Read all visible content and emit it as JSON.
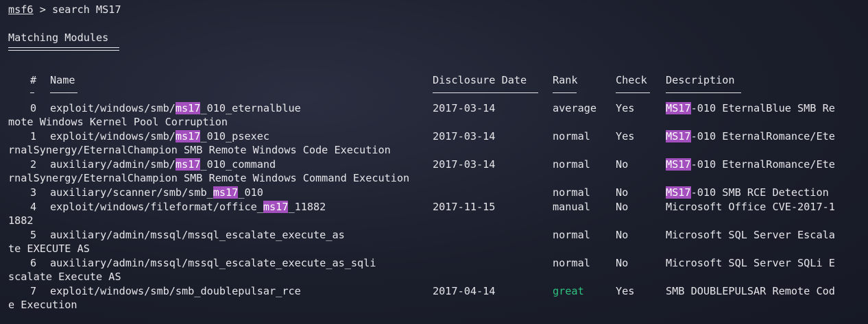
{
  "prompt": {
    "name": "msf6",
    "sep": " > ",
    "command": "search MS17"
  },
  "heading": "Matching Modules",
  "headers": {
    "num": "#",
    "name": "Name",
    "date": "Disclosure Date",
    "rank": "Rank",
    "check": "Check",
    "desc": "Description"
  },
  "highlight_term": "ms17",
  "rows": [
    {
      "num": "0",
      "name_pre": "exploit/windows/smb/",
      "name_hl": "ms17",
      "name_post": "_010_eternalblue",
      "date": "2017-03-14",
      "rank": "average",
      "check": "Yes",
      "desc_hl": "MS17",
      "desc_line1": "-010 EternalBlue SMB Re",
      "desc_line2": "mote Windows Kernel Pool Corruption"
    },
    {
      "num": "1",
      "name_pre": "exploit/windows/smb/",
      "name_hl": "ms17",
      "name_post": "_010_psexec",
      "date": "2017-03-14",
      "rank": "normal",
      "check": "Yes",
      "desc_hl": "MS17",
      "desc_line1": "-010 EternalRomance/Ete",
      "desc_line2": "rnalSynergy/EternalChampion SMB Remote Windows Code Execution"
    },
    {
      "num": "2",
      "name_pre": "auxiliary/admin/smb/",
      "name_hl": "ms17",
      "name_post": "_010_command",
      "date": "2017-03-14",
      "rank": "normal",
      "check": "No",
      "desc_hl": "MS17",
      "desc_line1": "-010 EternalRomance/Ete",
      "desc_line2": "rnalSynergy/EternalChampion SMB Remote Windows Command Execution"
    },
    {
      "num": "3",
      "name_pre": "auxiliary/scanner/smb/smb_",
      "name_hl": "ms17",
      "name_post": "_010",
      "date": "",
      "rank": "normal",
      "check": "No",
      "desc_hl": "MS17",
      "desc_line1": "-010 SMB RCE Detection",
      "desc_line2": ""
    },
    {
      "num": "4",
      "name_pre": "exploit/windows/fileformat/office_",
      "name_hl": "ms17",
      "name_post": "_11882",
      "date": "2017-11-15",
      "rank": "manual",
      "check": "No",
      "desc_hl": "",
      "desc_line1": "Microsoft Office CVE-2017-1",
      "desc_line2": "1882"
    },
    {
      "num": "5",
      "name_pre": "auxiliary/admin/mssql/mssql_escalate_execute_as",
      "name_hl": "",
      "name_post": "",
      "date": "",
      "rank": "normal",
      "check": "No",
      "desc_hl": "",
      "desc_line1": "Microsoft SQL Server Escala",
      "desc_line2": "te EXECUTE AS"
    },
    {
      "num": "6",
      "name_pre": "auxiliary/admin/mssql/mssql_escalate_execute_as_sqli",
      "name_hl": "",
      "name_post": "",
      "date": "",
      "rank": "normal",
      "check": "No",
      "desc_hl": "",
      "desc_line1": "Microsoft SQL Server SQLi E",
      "desc_line2": "scalate Execute AS"
    },
    {
      "num": "7",
      "name_pre": "exploit/windows/smb/smb_doublepulsar_rce",
      "name_hl": "",
      "name_post": "",
      "date": "2017-04-14",
      "rank": "great",
      "check": "Yes",
      "desc_hl": "",
      "desc_line1": "SMB DOUBLEPULSAR Remote Cod",
      "desc_line2": "e Execution"
    }
  ],
  "colors": {
    "background": "#1b1e2b",
    "text": "#e6e6ea",
    "highlight": "#a34fbe",
    "great": "#2ec27e"
  }
}
